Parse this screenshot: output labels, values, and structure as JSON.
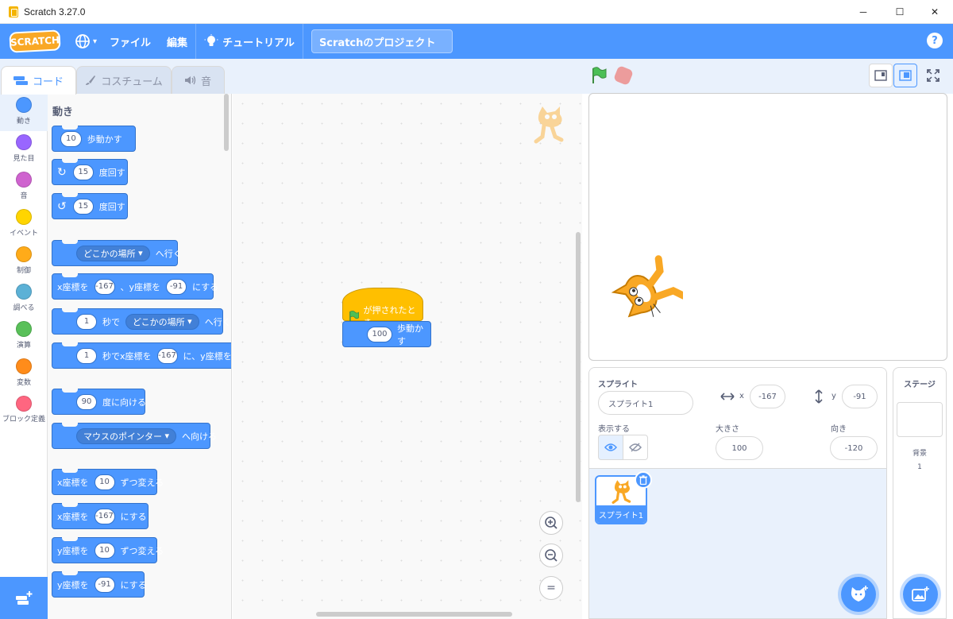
{
  "window": {
    "title": "Scratch 3.27.0",
    "minimize": "─",
    "maximize": "☐",
    "close": "✕"
  },
  "menubar": {
    "logo": "SCRATCH",
    "language_arrow": "▾",
    "file": "ファイル",
    "edit": "編集",
    "tutorials": "チュートリアル",
    "project_title": "Scratchのプロジェクト",
    "help": "?"
  },
  "tabs": {
    "code": "コード",
    "costumes": "コスチューム",
    "sounds": "音"
  },
  "categories": [
    {
      "label": "動き",
      "color": "#4c97ff"
    },
    {
      "label": "見た目",
      "color": "#9966ff"
    },
    {
      "label": "音",
      "color": "#cf63cf"
    },
    {
      "label": "イベント",
      "color": "#ffd500"
    },
    {
      "label": "制御",
      "color": "#ffab19"
    },
    {
      "label": "調べる",
      "color": "#5cb1d6"
    },
    {
      "label": "演算",
      "color": "#59c059"
    },
    {
      "label": "変数",
      "color": "#ff8c1a"
    },
    {
      "label": "ブロック定義",
      "color": "#ff6680"
    }
  ],
  "palette": {
    "section_title": "動き",
    "move": {
      "value": "10",
      "text": "歩動かす"
    },
    "turn_right": {
      "value": "15",
      "text": "度回す"
    },
    "turn_left": {
      "value": "15",
      "text": "度回す"
    },
    "goto": {
      "menu": "どこかの場所",
      "text": "へ行く"
    },
    "gotoxy": {
      "t1": "x座標を",
      "x": "-167",
      "t2": "、y座標を",
      "y": "-91",
      "t3": "にする"
    },
    "glide": {
      "secs": "1",
      "t1": "秒で",
      "menu": "どこかの場所",
      "t2": "へ行く"
    },
    "glidexy": {
      "secs": "1",
      "t1": "秒でx座標を",
      "x": "-167",
      "t2": "に、y座標を"
    },
    "point": {
      "value": "90",
      "text": "度に向ける"
    },
    "pointtowards": {
      "menu": "マウスのポインター",
      "text": "へ向ける"
    },
    "changex": {
      "t1": "x座標を",
      "value": "10",
      "t2": "ずつ変える"
    },
    "setx": {
      "t1": "x座標を",
      "value": "-167",
      "t2": "にする"
    },
    "changey": {
      "t1": "y座標を",
      "value": "10",
      "t2": "ずつ変える"
    },
    "sety": {
      "t1": "y座標を",
      "value": "-91",
      "t2": "にする"
    }
  },
  "workspace": {
    "hat_text": "が押されたとき",
    "move_value": "100",
    "move_text": "歩動かす",
    "zoom_in": "+",
    "zoom_out": "−",
    "zoom_reset": "="
  },
  "sprite_info": {
    "sprite_label": "スプライト",
    "sprite_name": "スプライト1",
    "x_label": "x",
    "x_value": "-167",
    "y_label": "y",
    "y_value": "-91",
    "show_label": "表示する",
    "size_label": "大きさ",
    "size_value": "100",
    "direction_label": "向き",
    "direction_value": "-120"
  },
  "sprite_tile": {
    "name": "スプライト1"
  },
  "stage_pane": {
    "title": "ステージ",
    "backdrops_label": "背景",
    "backdrops_count": "1"
  },
  "colors": {
    "accent": "#4c97ff",
    "events": "#ffbf00",
    "stage_bg": "#ffffff"
  }
}
